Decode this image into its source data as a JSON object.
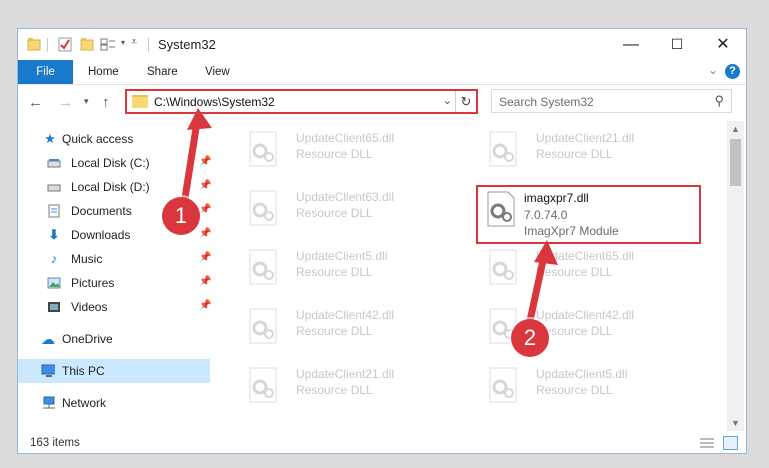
{
  "window": {
    "title": "System32",
    "controls": {
      "minimize": "—",
      "maximize": "☐",
      "close": "✕"
    }
  },
  "ribbon": {
    "tabs": [
      "File",
      "Home",
      "Share",
      "View"
    ],
    "help": "?"
  },
  "address": {
    "path": "C:\\Windows\\System32",
    "search_placeholder": "Search System32"
  },
  "sidebar": {
    "items": [
      {
        "label": "Quick access",
        "icon": "star-icon",
        "pinned": false
      },
      {
        "label": "Local Disk (C:)",
        "icon": "drive-icon",
        "pinned": true
      },
      {
        "label": "Local Disk (D:)",
        "icon": "drive-icon",
        "pinned": true
      },
      {
        "label": "Documents",
        "icon": "documents-icon",
        "pinned": true
      },
      {
        "label": "Downloads",
        "icon": "download-arrow-icon",
        "pinned": true
      },
      {
        "label": "Music",
        "icon": "music-note-icon",
        "pinned": true
      },
      {
        "label": "Pictures",
        "icon": "pictures-icon",
        "pinned": true
      },
      {
        "label": "Videos",
        "icon": "videos-icon",
        "pinned": true
      },
      {
        "label": "OneDrive",
        "icon": "cloud-icon",
        "pinned": false
      },
      {
        "label": "This PC",
        "icon": "monitor-icon",
        "pinned": false,
        "selected": true
      },
      {
        "label": "Network",
        "icon": "network-icon",
        "pinned": false
      }
    ]
  },
  "files": {
    "left_column": [
      {
        "name": "UpdateClient65.dll",
        "desc": "Resource DLL"
      },
      {
        "name": "UpdateClient63.dll",
        "desc": "Resource DLL"
      },
      {
        "name": "UpdateClient5.dll",
        "desc": "Resource DLL"
      },
      {
        "name": "UpdateClient42.dll",
        "desc": "Resource DLL"
      },
      {
        "name": "UpdateClient21.dll",
        "desc": "Resource DLL"
      }
    ],
    "right_column": [
      {
        "name": "UpdateClient21.dll",
        "desc": "Resource DLL"
      },
      {
        "name": "UpdateClient65.dll",
        "desc": "Resource DLL"
      },
      {
        "name": "UpdateClient65.dll",
        "desc": "Resource DLL"
      },
      {
        "name": "UpdateClient42.dll",
        "desc": "Resource DLL"
      },
      {
        "name": "UpdateClient5.dll",
        "desc": "Resource DLL"
      }
    ],
    "highlighted": {
      "name": "imagxpr7.dll",
      "version": "7.0.74.0",
      "desc": "ImagXpr7 Module"
    }
  },
  "status": {
    "count": "163 items"
  },
  "annotations": {
    "step1": "1",
    "step2": "2"
  },
  "colors": {
    "accent": "#1979ca",
    "highlight": "#d9363e",
    "selected_bg": "#cce8ff"
  }
}
